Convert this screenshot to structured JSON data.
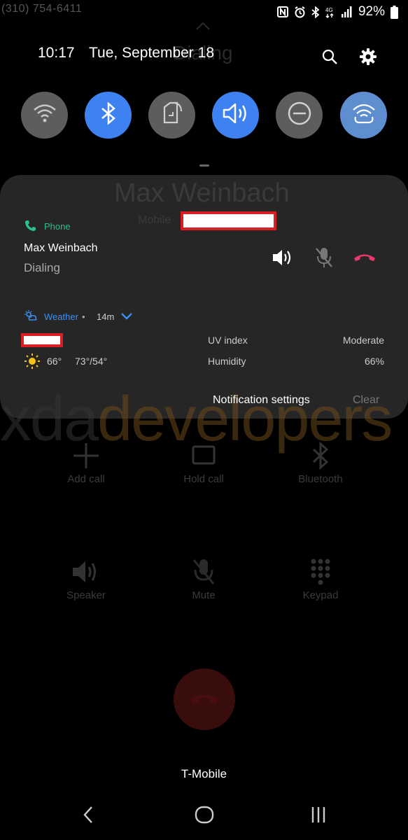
{
  "status_bar": {
    "left_text": "(310) 754-6411",
    "battery_percent": "92%"
  },
  "background_call": {
    "title": "Dialing",
    "contact_name": "Max Weinbach",
    "contact_type": "Mobile",
    "buttons": [
      {
        "label": "Add call",
        "icon": "add-icon"
      },
      {
        "label": "Hold call",
        "icon": "pause-icon"
      },
      {
        "label": "Bluetooth",
        "icon": "bluetooth-icon"
      },
      {
        "label": "Speaker",
        "icon": "speaker-icon"
      },
      {
        "label": "Mute",
        "icon": "mute-icon"
      },
      {
        "label": "Keypad",
        "icon": "keypad-icon"
      }
    ]
  },
  "quick_panel": {
    "time": "10:17",
    "date": "Tue, September 18",
    "tiles": [
      {
        "name": "wifi",
        "state": "off"
      },
      {
        "name": "bluetooth",
        "state": "on"
      },
      {
        "name": "auto-rotate",
        "state": "off"
      },
      {
        "name": "sound",
        "state": "on"
      },
      {
        "name": "do-not-disturb",
        "state": "off"
      },
      {
        "name": "mobile-hotspot",
        "state": "on"
      }
    ]
  },
  "notifications": {
    "call": {
      "app": "Phone",
      "contact": "Max Weinbach",
      "status": "Dialing"
    },
    "weather": {
      "app": "Weather",
      "time_ago": "14m",
      "temp_current": "66°",
      "temp_range": "73°/54°",
      "uv_label": "UV index",
      "uv_value": "Moderate",
      "humidity_label": "Humidity",
      "humidity_value": "66%"
    },
    "footer": {
      "settings": "Notification settings",
      "clear": "Clear"
    }
  },
  "watermark": "xdadevelopers",
  "carrier": "T-Mobile",
  "colors": {
    "accent_blue": "#3d82f0",
    "phone_green": "#2cc08c",
    "end_call_red": "#e8396a",
    "weather_blue": "#3b8ff0",
    "redaction_red": "#d91e24"
  }
}
